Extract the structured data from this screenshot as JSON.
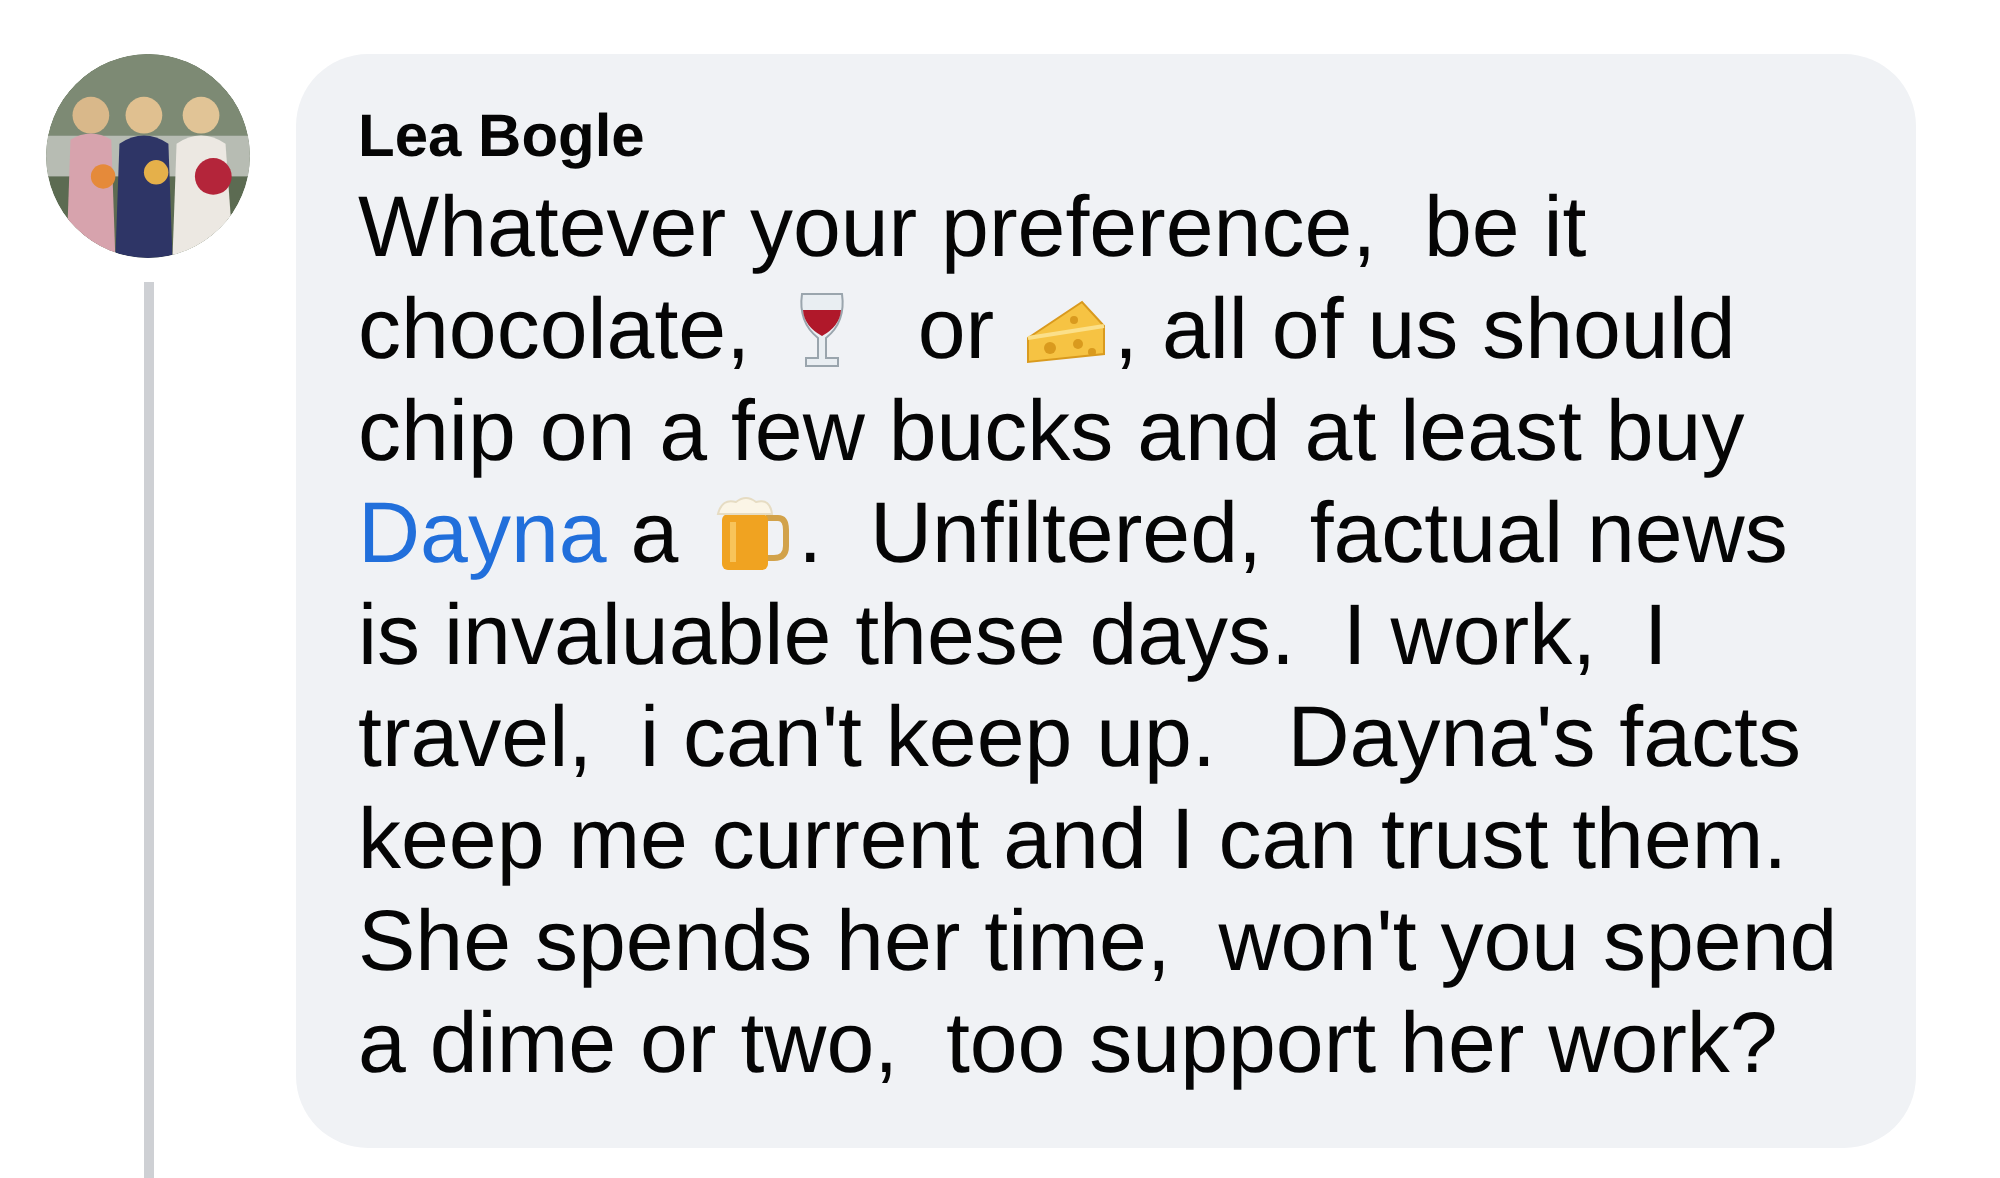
{
  "comment": {
    "author": "Lea Bogle",
    "body": [
      {
        "kind": "text",
        "text": "Whatever your preference,  be it chocolate, "
      },
      {
        "kind": "wine"
      },
      {
        "kind": "text",
        "text": "  or "
      },
      {
        "kind": "cheese"
      },
      {
        "kind": "text",
        "text": ", all of us should chip on a few bucks and at least buy "
      },
      {
        "kind": "link",
        "text": "Dayna"
      },
      {
        "kind": "text",
        "text": " a "
      },
      {
        "kind": "beer"
      },
      {
        "kind": "text",
        "text": ".  Unfiltered,  factual news is invaluable these days.  I work,  I travel,  i can't keep up.   Dayna's facts keep me current and I can trust them.  She spends her time,  won't you spend a dime or two,  too support her work?"
      }
    ]
  }
}
